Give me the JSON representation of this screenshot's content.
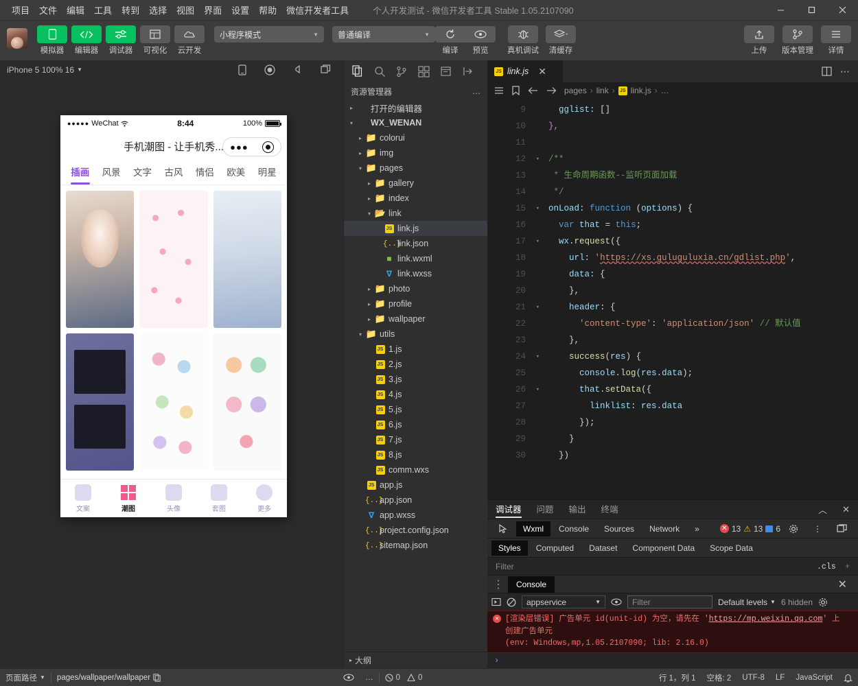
{
  "titlebar": {
    "menus": [
      "项目",
      "文件",
      "编辑",
      "工具",
      "转到",
      "选择",
      "视图",
      "界面",
      "设置",
      "帮助",
      "微信开发者工具"
    ],
    "window_title": "个人开发测试 - 微信开发者工具 Stable 1.05.2107090",
    "minimize": "—",
    "maximize": "▢",
    "close": "✕"
  },
  "toolbar": {
    "buttons": [
      {
        "label": "模拟器",
        "icon": "phone-icon",
        "style": "green"
      },
      {
        "label": "编辑器",
        "icon": "code-icon",
        "style": "green"
      },
      {
        "label": "调试器",
        "icon": "sliders-icon",
        "style": "green"
      },
      {
        "label": "可视化",
        "icon": "layout-icon",
        "style": "gray"
      },
      {
        "label": "云开发",
        "icon": "cloud-icon",
        "style": "gray"
      }
    ],
    "mode_select": "小程序模式",
    "compile_select": "普通编译",
    "actions": [
      {
        "label": "编译",
        "icon": "refresh-icon"
      },
      {
        "label": "预览",
        "icon": "eye-icon"
      },
      {
        "label": "真机调试",
        "icon": "bug-icon"
      },
      {
        "label": "清缓存",
        "icon": "layers-icon"
      }
    ],
    "right_buttons": [
      {
        "label": "上传",
        "icon": "upload-icon"
      },
      {
        "label": "版本管理",
        "icon": "branch-icon"
      },
      {
        "label": "详情",
        "icon": "menu-icon"
      }
    ]
  },
  "simulator": {
    "device_label": "iPhone 5 100% 16",
    "toolbar_icons": [
      "rotate-icon",
      "record-icon",
      "volume-icon",
      "window-icon"
    ],
    "phone": {
      "status": {
        "carrier_dots": "●●●●●",
        "carrier": "WeChat",
        "wifi": "wifi-icon",
        "time": "8:44",
        "battery_pct": "100%"
      },
      "nav_title": "手机潮图 - 让手机秀...",
      "capsule_more": "●●●",
      "tabs": [
        "插画",
        "风景",
        "文字",
        "古风",
        "情侣",
        "欧美",
        "明星"
      ],
      "active_tab": "插画",
      "grid_cells": [
        "anime-illustration",
        "pink-pattern",
        "gradient-wallpaper",
        "photo-collage",
        "doodle-sticker",
        "sticker-sheet"
      ],
      "bottom_tabs": [
        {
          "label": "文案",
          "icon": "heart-icon"
        },
        {
          "label": "潮图",
          "icon": "grid-icon"
        },
        {
          "label": "头像",
          "icon": "avatar-icon"
        },
        {
          "label": "套图",
          "icon": "album-icon"
        },
        {
          "label": "更多",
          "icon": "more-icon"
        }
      ],
      "bottom_active": "潮图"
    }
  },
  "explorer": {
    "activity_icons": [
      "files-icon",
      "search-icon",
      "source-control-icon",
      "extensions-icon",
      "debug-icon",
      "collapse-icon"
    ],
    "header": "资源管理器",
    "header_more": "…",
    "tree": [
      {
        "label": "打开的编辑器",
        "indent": 0,
        "type": "section",
        "twist": "▸"
      },
      {
        "label": "WX_WENAN",
        "indent": 0,
        "type": "root",
        "twist": "▾"
      },
      {
        "label": "colorui",
        "indent": 1,
        "type": "folder",
        "twist": "▸"
      },
      {
        "label": "img",
        "indent": 1,
        "type": "folder-green",
        "twist": "▸"
      },
      {
        "label": "pages",
        "indent": 1,
        "type": "folder-red",
        "twist": "▾"
      },
      {
        "label": "gallery",
        "indent": 2,
        "type": "folder",
        "twist": "▸"
      },
      {
        "label": "index",
        "indent": 2,
        "type": "folder",
        "twist": "▸"
      },
      {
        "label": "link",
        "indent": 2,
        "type": "folder-open",
        "twist": "▾"
      },
      {
        "label": "link.js",
        "indent": 3,
        "type": "js",
        "twist": "",
        "selected": true
      },
      {
        "label": "link.json",
        "indent": 3,
        "type": "json",
        "twist": ""
      },
      {
        "label": "link.wxml",
        "indent": 3,
        "type": "wxml",
        "twist": ""
      },
      {
        "label": "link.wxss",
        "indent": 3,
        "type": "wxss",
        "twist": ""
      },
      {
        "label": "photo",
        "indent": 2,
        "type": "folder",
        "twist": "▸"
      },
      {
        "label": "profile",
        "indent": 2,
        "type": "folder",
        "twist": "▸"
      },
      {
        "label": "wallpaper",
        "indent": 2,
        "type": "folder",
        "twist": "▸"
      },
      {
        "label": "utils",
        "indent": 1,
        "type": "folder-lgreen",
        "twist": "▾"
      },
      {
        "label": "1.js",
        "indent": 2,
        "type": "js",
        "twist": ""
      },
      {
        "label": "2.js",
        "indent": 2,
        "type": "js",
        "twist": ""
      },
      {
        "label": "3.js",
        "indent": 2,
        "type": "js",
        "twist": ""
      },
      {
        "label": "4.js",
        "indent": 2,
        "type": "js",
        "twist": ""
      },
      {
        "label": "5.js",
        "indent": 2,
        "type": "js",
        "twist": ""
      },
      {
        "label": "6.js",
        "indent": 2,
        "type": "js",
        "twist": ""
      },
      {
        "label": "7.js",
        "indent": 2,
        "type": "js",
        "twist": ""
      },
      {
        "label": "8.js",
        "indent": 2,
        "type": "js",
        "twist": ""
      },
      {
        "label": "comm.wxs",
        "indent": 2,
        "type": "js",
        "twist": ""
      },
      {
        "label": "app.js",
        "indent": 1,
        "type": "js",
        "twist": ""
      },
      {
        "label": "app.json",
        "indent": 1,
        "type": "json",
        "twist": ""
      },
      {
        "label": "app.wxss",
        "indent": 1,
        "type": "wxss",
        "twist": ""
      },
      {
        "label": "project.config.json",
        "indent": 1,
        "type": "json",
        "twist": ""
      },
      {
        "label": "sitemap.json",
        "indent": 1,
        "type": "json",
        "twist": ""
      }
    ],
    "footer": "大纲",
    "footer_twist": "▸"
  },
  "editor": {
    "tab": {
      "name": "link.js",
      "close": "✕"
    },
    "tab_right_icons": [
      "split-editor-icon",
      "more-actions-icon"
    ],
    "breadcrumb": [
      "pages",
      "link",
      "link.js",
      "…"
    ],
    "breadcrumb_icons": [
      "outline-icon",
      "bookmark-icon",
      "back-icon",
      "forward-icon"
    ],
    "lines": [
      {
        "num": "9",
        "fold": "",
        "html": "    <span class='k-key'>gglist</span><span class='k-plain'>: </span><span class='k-yellow'>[]</span>"
      },
      {
        "num": "10",
        "fold": "",
        "html": "  <span class='k-brk'>},</span>"
      },
      {
        "num": "11",
        "fold": "",
        "html": ""
      },
      {
        "num": "12",
        "fold": "▾",
        "html": "  <span class='k-cm'>/**</span>"
      },
      {
        "num": "13",
        "fold": "",
        "html": "   <span class='k-cm'>* 生命周期函数--监听页面加载</span>"
      },
      {
        "num": "14",
        "fold": "",
        "html": "   <span class='k-cm'>*/</span>"
      },
      {
        "num": "15",
        "fold": "▾",
        "html": "  <span class='k-key'>onLoad</span><span class='k-plain'>: </span><span class='k-kw'>function</span> <span class='k-par'>(</span><span class='k-pm'>options</span><span class='k-par'>) {</span>"
      },
      {
        "num": "16",
        "fold": "",
        "html": "    <span class='k-kw'>var</span> <span class='k-key'>that</span> <span class='k-plain'>=</span> <span class='k-kw'>this</span><span class='k-plain'>;</span>"
      },
      {
        "num": "17",
        "fold": "▾",
        "html": "    <span class='k-key'>wx</span><span class='k-plain'>.</span><span class='k-fn'>request</span><span class='k-par'>({</span>"
      },
      {
        "num": "18",
        "fold": "",
        "html": "      <span class='k-key'>url</span><span class='k-plain'>: </span><span class='k-str'>'</span><span class='k-str squiggle'>https://xs.guluguluxia.cn/gdlist.php</span><span class='k-str'>'</span><span class='k-plain'>,</span>"
      },
      {
        "num": "19",
        "fold": "",
        "html": "      <span class='k-key'>data</span><span class='k-plain'>: </span><span class='k-par'>{</span>"
      },
      {
        "num": "20",
        "fold": "",
        "html": "      <span class='k-par'>},</span>"
      },
      {
        "num": "21",
        "fold": "▾",
        "html": "      <span class='k-key'>header</span><span class='k-plain'>: </span><span class='k-par'>{</span>"
      },
      {
        "num": "22",
        "fold": "",
        "html": "        <span class='k-str'>'content-type'</span><span class='k-plain'>: </span><span class='k-str'>'application/json'</span> <span class='k-cm'>// 默认值</span>"
      },
      {
        "num": "23",
        "fold": "",
        "html": "      <span class='k-par'>},</span>"
      },
      {
        "num": "24",
        "fold": "▾",
        "html": "      <span class='k-fn'>success</span><span class='k-par'>(</span><span class='k-pm'>res</span><span class='k-par'>) {</span>"
      },
      {
        "num": "25",
        "fold": "",
        "html": "        <span class='k-key'>console</span><span class='k-plain'>.</span><span class='k-fn'>log</span><span class='k-par'>(</span><span class='k-key'>res</span><span class='k-plain'>.</span><span class='k-key'>data</span><span class='k-par'>)</span><span class='k-plain'>;</span>"
      },
      {
        "num": "26",
        "fold": "▾",
        "html": "        <span class='k-key'>that</span><span class='k-plain'>.</span><span class='k-fn'>setData</span><span class='k-par'>({</span>"
      },
      {
        "num": "27",
        "fold": "",
        "html": "          <span class='k-key'>linklist</span><span class='k-plain'>: </span><span class='k-key'>res</span><span class='k-plain'>.</span><span class='k-key'>data</span>"
      },
      {
        "num": "28",
        "fold": "",
        "html": "        <span class='k-par'>})</span><span class='k-plain'>;</span>"
      },
      {
        "num": "29",
        "fold": "",
        "html": "      <span class='k-par'>}</span>"
      },
      {
        "num": "30",
        "fold": "",
        "html": "    <span class='k-par'>})</span>"
      }
    ]
  },
  "devtools": {
    "panel_tabs": [
      "调试器",
      "问题",
      "输出",
      "终端"
    ],
    "panel_active": "调试器",
    "panel_icons": [
      "chevron-up-icon",
      "close-icon"
    ],
    "inspector_tabs": [
      "Wxml",
      "Console",
      "Sources",
      "Network"
    ],
    "inspector_active": "Wxml",
    "inspector_more": "»",
    "select_icon": "element-picker-icon",
    "counts": {
      "errors": "13",
      "warnings": "13",
      "infos": "6"
    },
    "right_icons": [
      "gear-icon",
      "more-vertical-icon",
      "dock-icon"
    ],
    "style_tabs": [
      "Styles",
      "Computed",
      "Dataset",
      "Component Data",
      "Scope Data"
    ],
    "style_active": "Styles",
    "filter_placeholder": "Filter",
    "cls_label": ".cls",
    "plus": "+"
  },
  "console": {
    "tab": "Console",
    "drag_icon": "drag-handle-icon",
    "close_icon": "✕",
    "exec_icon": "execution-context-icon",
    "clear_icon": "clear-console-icon",
    "context": "appservice",
    "eye_icon": "eye-icon",
    "filter_placeholder": "Filter",
    "levels": "Default levels",
    "hidden": "6 hidden",
    "gear_icon": "gear-icon",
    "error": {
      "line1_before": "[渲染层错误] 广告单元 id(unit-id) 为空，请先在 '",
      "line1_link": "https://mp.weixin.qq.com",
      "line1_after": "' 上",
      "line2": "创建广告单元",
      "line3": "(env: Windows,mp,1.05.2107090; lib: 2.16.0)"
    },
    "prompt": "›"
  },
  "statusbar": {
    "page_path_label": "页面路径",
    "page_path": "pages/wallpaper/wallpaper",
    "copy_icon": "copy-icon",
    "eye_icon": "eye-icon",
    "more_icon": "…",
    "errors": "0",
    "warnings": "0",
    "cursor": "行 1，列 1",
    "spaces": "空格: 2",
    "encoding": "UTF-8",
    "eol": "LF",
    "language": "JavaScript",
    "bell_icon": "bell-icon"
  }
}
